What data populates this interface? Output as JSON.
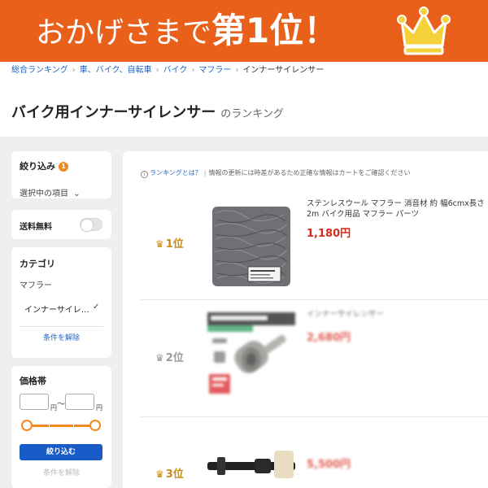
{
  "banner": {
    "lead": "おかげさまで",
    "highlight": "第1位！",
    "crown_icon": "crown-icon",
    "background_color": "#e8601a",
    "crown_color": "#f5d13a"
  },
  "breadcrumb": {
    "items": [
      "総合ランキング",
      "車、バイク、自転車",
      "バイク",
      "マフラー"
    ],
    "current": "インナーサイレンサー"
  },
  "page": {
    "title": "バイク用インナーサイレンサー",
    "title_suffix": "のランキング"
  },
  "sidebar": {
    "filter": {
      "label": "絞り込み",
      "badge_count": "1",
      "selected_items_label": "選択中の項目"
    },
    "shipping": {
      "label": "送料無料",
      "toggle_on": false
    },
    "category": {
      "label": "カテゴリ",
      "parent": "マフラー",
      "current": "インナーサイレ…",
      "clear_label": "条件を解除"
    },
    "price": {
      "label": "価格帯",
      "min_value": "",
      "max_value": "",
      "currency": "円",
      "separator": "〜",
      "apply_label": "絞り込む",
      "clear_label": "条件を解除",
      "accent_color": "#f08a1c",
      "button_color": "#1a5cc7"
    }
  },
  "main": {
    "info_link": "ランキングとは？",
    "info_text": "情報の更新には時差があるため正確な情報はカートをご確認ください",
    "items": [
      {
        "rank_label": "1位",
        "title": "ステンレスウール マフラー 消音材 約 幅6cmx長さ2m バイク用品 マフラー パーツ",
        "price": "1,180円",
        "blurred": false
      },
      {
        "rank_label": "2位",
        "title": "インナーサイレンサー",
        "price": "2,680円",
        "blurred": true
      },
      {
        "rank_label": "3位",
        "title": "",
        "price": "5,500円",
        "blurred": true
      }
    ]
  }
}
